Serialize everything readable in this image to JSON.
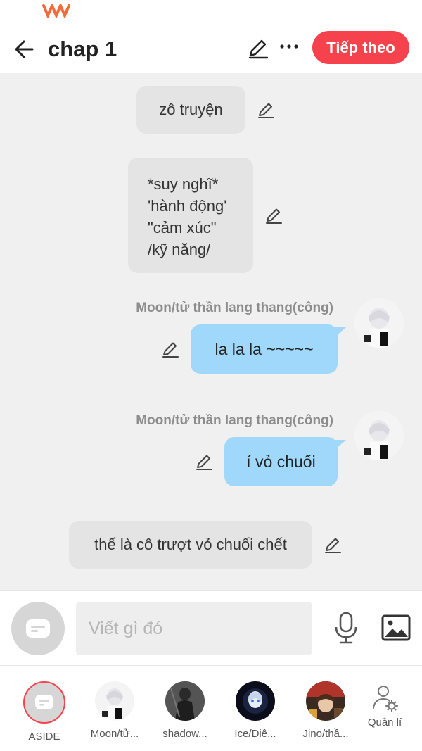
{
  "header": {
    "title": "chap 1",
    "next_label": "Tiếp theo"
  },
  "messages": [
    {
      "type": "narration",
      "text": "zô truyện"
    },
    {
      "type": "narration",
      "lines": [
        "*suy nghĩ*",
        "'hành động'",
        "\"cảm xúc\"",
        "/kỹ năng/"
      ]
    },
    {
      "type": "character",
      "speaker": "Moon/tử thần lang thang(công)",
      "text": "la la la ~~~~~"
    },
    {
      "type": "character",
      "speaker": "Moon/tử thần lang thang(công)",
      "text": "í vỏ chuối"
    },
    {
      "type": "narration",
      "text": "thế là cô trượt vỏ chuối chết"
    }
  ],
  "composer": {
    "placeholder": "Viết gì đó"
  },
  "characters": [
    {
      "label": "ASIDE",
      "icon": "chat-bubble-icon"
    },
    {
      "label": "Moon/tử...",
      "icon": "avatar-white-hair"
    },
    {
      "label": "shadow...",
      "icon": "avatar-dark-figure"
    },
    {
      "label": "Ice/Diê...",
      "icon": "avatar-ice"
    },
    {
      "label": "Jino/thầ...",
      "icon": "avatar-jino"
    },
    {
      "label": "Quản lí",
      "icon": "manage-user-icon"
    }
  ],
  "colors": {
    "accent": "#f5424d",
    "bubble_me": "#9fd8fb",
    "bubble_narration": "#e4e4e4"
  }
}
